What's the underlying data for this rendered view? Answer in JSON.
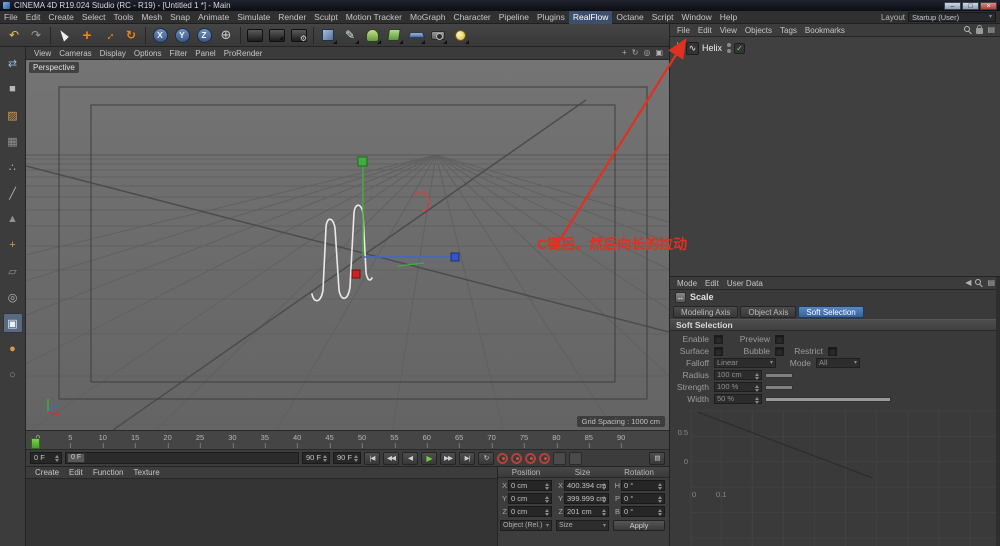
{
  "titlebar": {
    "title": "CINEMA 4D R19.024 Studio (RC - R19) - [Untitled 1 *] - Main",
    "minimize": "–",
    "maximize": "□",
    "close": "×"
  },
  "menubar": {
    "items": [
      "File",
      "Edit",
      "Create",
      "Select",
      "Tools",
      "Mesh",
      "Snap",
      "Animate",
      "Simulate",
      "Render",
      "Sculpt",
      "Motion Tracker",
      "MoGraph",
      "Character",
      "Pipeline",
      "Plugins",
      "RealFlow",
      "Octane",
      "Script",
      "Window",
      "Help"
    ],
    "highlight": "RealFlow",
    "layout_label": "Layout",
    "layout_value": "Startup (User)"
  },
  "toolbar": {
    "x_label": "X",
    "y_label": "Y",
    "z_label": "Z"
  },
  "left_toolbar": {
    "items": [
      {
        "glyph": "⇄"
      },
      {
        "glyph": "■"
      },
      {
        "glyph": "▨"
      },
      {
        "glyph": "▦"
      },
      {
        "glyph": "∴"
      },
      {
        "glyph": "╱"
      },
      {
        "glyph": "▲"
      },
      {
        "glyph": "+"
      },
      {
        "glyph": "▱"
      },
      {
        "glyph": "◎"
      },
      {
        "glyph": "▣"
      },
      {
        "glyph": "●"
      },
      {
        "glyph": "○"
      }
    ]
  },
  "viewport": {
    "menu": [
      "View",
      "Cameras",
      "Display",
      "Options",
      "Filter",
      "Panel",
      "ProRender"
    ],
    "camera_label": "Perspective",
    "grid_spacing_label": "Grid Spacing : 1000 cm",
    "annotation_text": "C键后，然后向长的拉动"
  },
  "object_manager": {
    "menu": [
      "File",
      "Edit",
      "View",
      "Objects",
      "Tags",
      "Bookmarks"
    ],
    "object_name": "Helix"
  },
  "attribute_manager": {
    "menu": [
      "Mode",
      "Edit",
      "User Data"
    ],
    "tool_name": "Scale",
    "tabs": [
      "Modeling Axis",
      "Object Axis",
      "Soft Selection"
    ],
    "active_tab": "Soft Selection",
    "section_title": "Soft Selection",
    "rows": {
      "enable_label": "Enable",
      "preview_label": "Preview",
      "surface_label": "Surface",
      "bubble_label": "Bubble",
      "restrict_label": "Restrict",
      "falloff_label": "Falloff",
      "falloff_value": "Linear",
      "mode_label": "Mode",
      "mode_value": "All",
      "radius_label": "Radius",
      "radius_value": "100 cm",
      "strength_label": "Strength",
      "strength_value": "100 %",
      "width_label": "Width",
      "width_value": "50 %"
    },
    "graph": {
      "y_mid": "0.5",
      "y_zero": "0",
      "x_zero": "0",
      "x_first": "0.1"
    }
  },
  "timeline": {
    "ticks": [
      "0",
      "5",
      "10",
      "15",
      "20",
      "25",
      "30",
      "35",
      "40",
      "45",
      "50",
      "55",
      "60",
      "65",
      "70",
      "75",
      "80",
      "85",
      "90"
    ]
  },
  "transport": {
    "current_frame": "0 F",
    "slider_label": "0 F",
    "range_end": "90 F",
    "last_frame": "90 F"
  },
  "materials_panel": {
    "menu": [
      "Create",
      "Edit",
      "Function",
      "Texture"
    ]
  },
  "coordinates": {
    "headers": [
      "Position",
      "Size",
      "Rotation"
    ],
    "position": [
      {
        "axis": "X",
        "value": "0 cm"
      },
      {
        "axis": "Y",
        "value": "0 cm"
      },
      {
        "axis": "Z",
        "value": "0 cm"
      }
    ],
    "size": [
      {
        "axis": "X",
        "value": "400.394 cm"
      },
      {
        "axis": "Y",
        "value": "399.999 cm"
      },
      {
        "axis": "Z",
        "value": "201 cm"
      }
    ],
    "rotation": [
      {
        "axis": "H",
        "value": "0 °"
      },
      {
        "axis": "P",
        "value": "0 °"
      },
      {
        "axis": "B",
        "value": "0 °"
      }
    ],
    "position_mode": "Object (Rel.)",
    "size_mode": "Size",
    "apply_label": "Apply"
  },
  "icons": {
    "undo": "↶",
    "redo": "↷",
    "move": "+",
    "scale": "↔",
    "rotate": "↻",
    "globe": "⊕",
    "gear": "⚙",
    "pen": "✎",
    "caret_down": "▾",
    "check": "✓",
    "helix": "∿",
    "goto_start": "|◀",
    "prev_key": "◀◀",
    "prev_frame": "◀",
    "play": "▶",
    "next_key": "▶▶",
    "goto_end": "▶|",
    "loop": "↻",
    "viewport_pan": "+",
    "viewport_orbit": "↻",
    "viewport_zoom": "◎",
    "viewport_maximize": "▣",
    "menu_grid": "▤",
    "back": "◀"
  },
  "accent_colors": {
    "annotation_red": "#e03020",
    "tab_active_blue": "#35619e",
    "play_green": "#6fd03c"
  }
}
